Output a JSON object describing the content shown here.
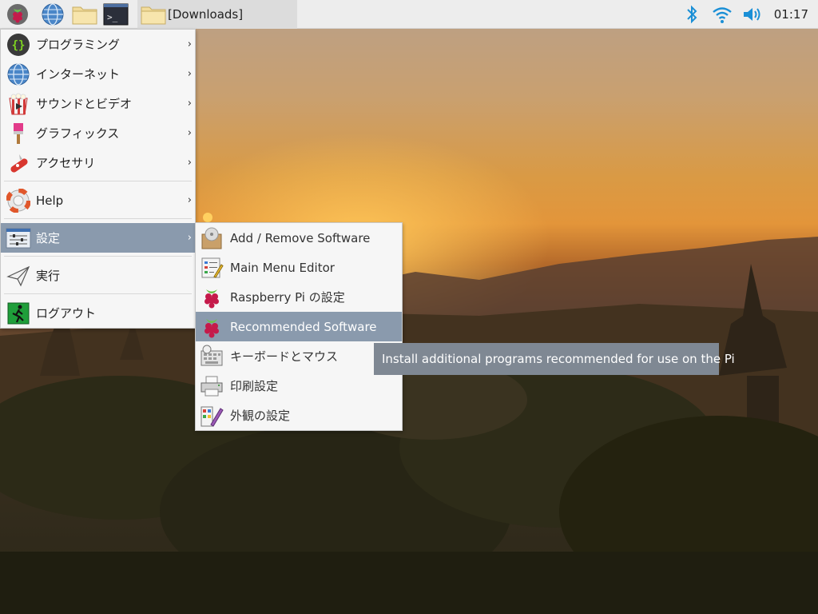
{
  "taskbar": {
    "window_title": "[Downloads]",
    "clock": "01:17",
    "launchers": [
      {
        "icon": "raspberry-icon"
      },
      {
        "icon": "globe-icon"
      },
      {
        "icon": "folder-icon"
      },
      {
        "icon": "terminal-icon",
        "glyph": ">_"
      }
    ],
    "tray": [
      {
        "icon": "bluetooth-icon"
      },
      {
        "icon": "wifi-icon"
      },
      {
        "icon": "volume-icon"
      }
    ]
  },
  "menu": {
    "items": [
      {
        "label": "プログラミング",
        "icon": "programming-icon",
        "has_submenu": true
      },
      {
        "label": "インターネット",
        "icon": "globe-icon",
        "has_submenu": true
      },
      {
        "label": "サウンドとビデオ",
        "icon": "sound-video-icon",
        "has_submenu": true
      },
      {
        "label": "グラフィックス",
        "icon": "graphics-icon",
        "has_submenu": true
      },
      {
        "label": "アクセサリ",
        "icon": "accessories-icon",
        "has_submenu": true
      },
      {
        "label": "Help",
        "icon": "help-icon",
        "has_submenu": true
      },
      {
        "label": "設定",
        "icon": "preferences-icon",
        "has_submenu": true,
        "active": true
      },
      {
        "label": "実行",
        "icon": "run-icon",
        "has_submenu": false
      },
      {
        "label": "ログアウト",
        "icon": "logout-icon",
        "has_submenu": false
      }
    ],
    "arrow": "›"
  },
  "submenu": {
    "items": [
      {
        "label": "Add / Remove Software",
        "icon": "package-icon"
      },
      {
        "label": "Main Menu Editor",
        "icon": "menu-editor-icon"
      },
      {
        "label": "Raspberry Pi の設定",
        "icon": "raspberry-icon"
      },
      {
        "label": "Recommended Software",
        "icon": "raspberry-icon",
        "active": true
      },
      {
        "label": "キーボードとマウス",
        "icon": "keyboard-mouse-icon"
      },
      {
        "label": "印刷設定",
        "icon": "printer-icon"
      },
      {
        "label": "外観の設定",
        "icon": "appearance-icon"
      }
    ]
  },
  "tooltip": {
    "text": "Install additional programs recommended for use on the Pi"
  },
  "colors": {
    "highlight": "#8a9aad",
    "menu_bg": "#f6f6f6",
    "tooltip_bg": "#7f8893",
    "accent": "#1a8fd6"
  }
}
